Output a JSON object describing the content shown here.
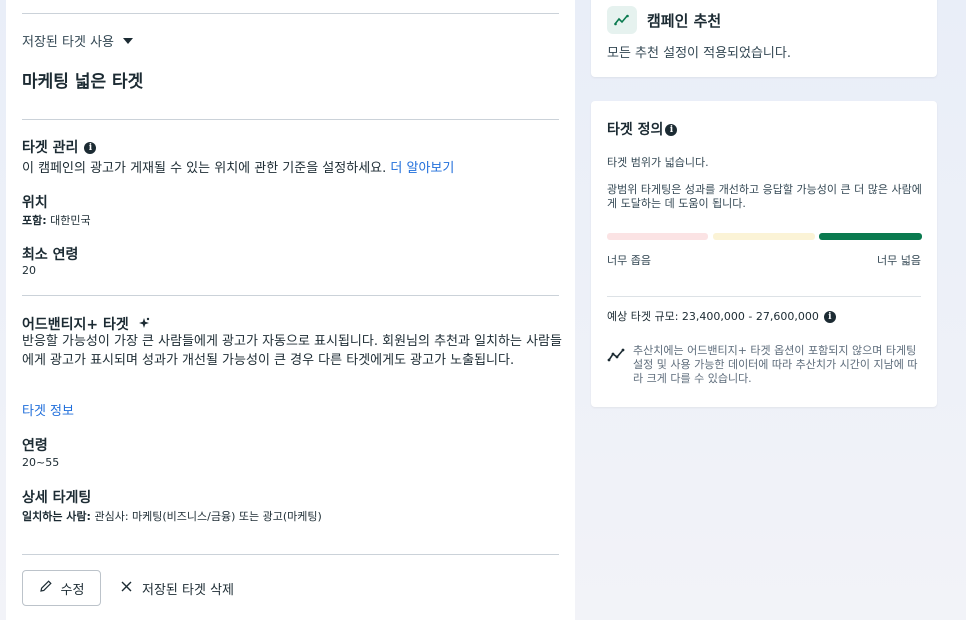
{
  "left": {
    "saved_audience_label": "저장된 타겟 사용",
    "audience_name": "마케팅 넓은 타겟",
    "targeting_mgmt": {
      "title": "타겟 관리",
      "desc": "이 캠페인의 광고가 게재될 수 있는 위치에 관한 기준을 설정하세요.",
      "learn_more": "더 알아보기"
    },
    "location": {
      "title": "위치",
      "prefix": "포함:",
      "value": "대한민국"
    },
    "min_age": {
      "title": "최소 연령",
      "value": "20"
    },
    "advantage": {
      "title": "어드밴티지+ 타겟",
      "desc": "반응할 가능성이 가장 큰 사람들에게 광고가 자동으로 표시됩니다. 회원님의 추천과 일치하는 사람들에게 광고가 표시되며 성과가 개선될 가능성이 큰 경우 다른 타겟에게도 광고가 노출됩니다.",
      "info_link": "타겟 정보"
    },
    "age": {
      "title": "연령",
      "value": "20~55"
    },
    "detailed": {
      "title": "상세 타게팅",
      "prefix": "일치하는 사람:",
      "value": "관심사: 마케팅(비즈니스/금융) 또는 광고(마케팅)"
    },
    "edit_button": "수정",
    "delete_button": "저장된 타겟 삭제"
  },
  "right": {
    "recommendation": {
      "title": "캠페인 추천",
      "desc": "모든 추천 설정이 적용되었습니다."
    },
    "definition": {
      "title": "타겟 정의",
      "breadth_status": "타겟 범위가 넓습니다.",
      "desc": "광범위 타게팅은 성과를 개선하고 응답할 가능성이 큰 더 많은 사람에게 도달하는 데 도움이 됩니다.",
      "narrow_label": "너무 좁음",
      "broad_label": "너무 넓음",
      "estimate_label": "예상 타겟 규모:",
      "estimate_value": "23,400,000 - 27,600,000",
      "note": "추산치에는 어드밴티지+ 타겟 옵션이 포함되지 않으며 타게팅 설정 및 사용 가능한 데이터에 따라 추산치가 시간이 지남에 따라 크게 다를 수 있습니다."
    },
    "meter_colors": [
      "#fbe3e4",
      "#fbf3d6",
      "#0a7a4f"
    ]
  }
}
